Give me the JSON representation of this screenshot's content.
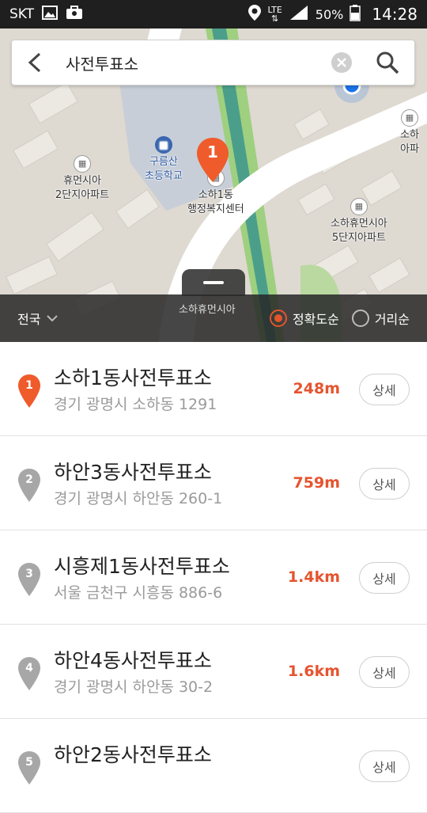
{
  "status_bar": {
    "carrier": "SKT",
    "network": "LTE",
    "battery": "50%",
    "time": "14:28"
  },
  "search": {
    "query": "사전투표소"
  },
  "map": {
    "labels": {
      "school": "구름산\n초등학교",
      "apt2": "휴먼시아\n2단지아파트",
      "center": "소하1동\n행정복지센터",
      "apt5": "소하휴먼시아\n5단지아파트",
      "apt_right": "소하\n아파",
      "apt_bottom": "소하휴먼시아"
    },
    "marker_number": "1"
  },
  "filter": {
    "region": "전국",
    "sort_accuracy": "정확도순",
    "sort_distance": "거리순",
    "selected": "정확도순"
  },
  "results": [
    {
      "num": "1",
      "name": "소하1동사전투표소",
      "address": "경기 광명시 소하동 1291",
      "distance": "248m",
      "detail": "상세",
      "active": true
    },
    {
      "num": "2",
      "name": "하안3동사전투표소",
      "address": "경기 광명시 하안동 260-1",
      "distance": "759m",
      "detail": "상세",
      "active": false
    },
    {
      "num": "3",
      "name": "시흥제1동사전투표소",
      "address": "서울 금천구 시흥동 886-6",
      "distance": "1.4km",
      "detail": "상세",
      "active": false
    },
    {
      "num": "4",
      "name": "하안4동사전투표소",
      "address": "경기 광명시 하안동 30-2",
      "distance": "1.6km",
      "detail": "상세",
      "active": false
    },
    {
      "num": "5",
      "name": "하안2동사전투표소",
      "address": "",
      "distance": "",
      "detail": "상세",
      "active": false
    }
  ],
  "colors": {
    "accent": "#e5542e",
    "pin_inactive": "#a7a7a7",
    "map_bg": "#ded9d1",
    "park_green": "#9fd07f",
    "water": "#2f8f8d"
  }
}
